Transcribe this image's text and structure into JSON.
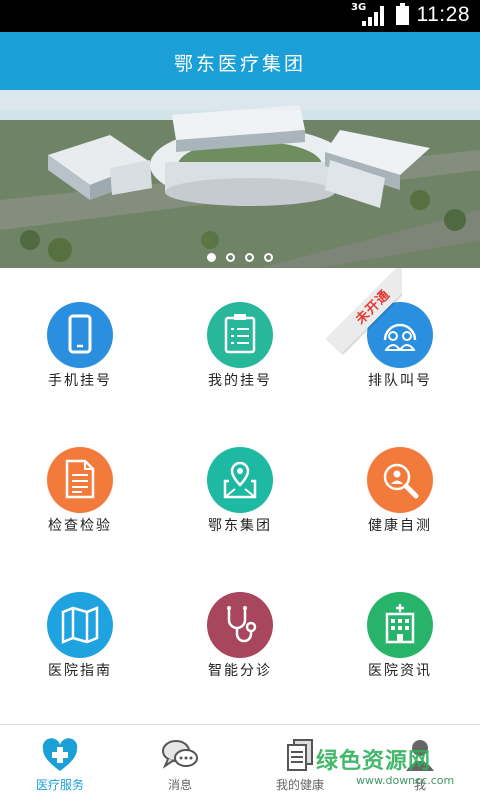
{
  "status_bar": {
    "network": "3G",
    "time": "11:28"
  },
  "header": {
    "title": "鄂东医疗集团"
  },
  "banner": {
    "image": "hospital-campus-aerial-rendering",
    "slides": 4,
    "active_slide": 1
  },
  "grid": {
    "items": [
      {
        "label": "手机挂号",
        "icon": "mobile-phone-icon",
        "color": "#2b8fe0"
      },
      {
        "label": "我的挂号",
        "icon": "clipboard-list-icon",
        "color": "#27b79a"
      },
      {
        "label": "排队叫号",
        "icon": "queue-people-icon",
        "color": "#2b8fe0"
      },
      {
        "label": "检查检验",
        "icon": "document-icon",
        "color": "#f27a3b"
      },
      {
        "label": "鄂东集团",
        "icon": "map-pin-icon",
        "color": "#1eb9a3"
      },
      {
        "label": "健康自测",
        "icon": "magnifier-person-icon",
        "color": "#f27a3b"
      },
      {
        "label": "医院指南",
        "icon": "map-icon",
        "color": "#1fa3e0"
      },
      {
        "label": "智能分诊",
        "icon": "stethoscope-icon",
        "color": "#a7465c"
      },
      {
        "label": "医院资讯",
        "icon": "hospital-building-icon",
        "color": "#27b46a"
      }
    ],
    "ribbon": "未开通"
  },
  "tabbar": {
    "tabs": [
      {
        "label": "医疗服务",
        "icon": "heart-plus-icon",
        "active": true
      },
      {
        "label": "消息",
        "icon": "chat-bubbles-icon",
        "active": false
      },
      {
        "label": "我的健康",
        "icon": "documents-stack-icon",
        "active": false
      },
      {
        "label": "我",
        "icon": "person-icon",
        "active": false
      }
    ]
  },
  "watermark": {
    "main": "绿色资源网",
    "sub": "www.downcc.com"
  },
  "colors": {
    "brand": "#1a9fd6",
    "ribbon_text": "#e53935"
  }
}
